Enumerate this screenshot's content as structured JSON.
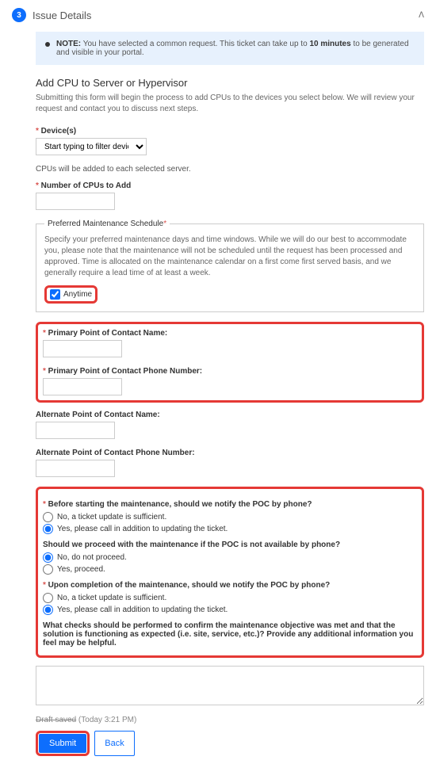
{
  "header": {
    "step": "3",
    "title": "Issue Details"
  },
  "note": {
    "label": "NOTE:",
    "body": " You have selected a common request. This ticket can take up to ",
    "bold": "10 minutes",
    "tail": " to be generated and visible in your portal."
  },
  "form": {
    "title": "Add CPU to Server or Hypervisor",
    "subtitle": "Submitting this form will begin the process to add CPUs to the devices you select below. We will review your request and contact you to discuss next steps.",
    "devices_label": "Device(s)",
    "devices_placeholder": "Start typing to filter devices",
    "devices_helper": "CPUs will be added to each selected server.",
    "num_cpus_label": "Number of CPUs to Add"
  },
  "schedule": {
    "legend": "Preferred Maintenance Schedule",
    "desc": "Specify your preferred maintenance days and time windows. While we will do our best to accommodate you, please note that the maintenance will not be scheduled until the request has been processed and approved. Time is allocated on the maintenance calendar on a first come first served basis, and we generally require a lead time of at least a week.",
    "anytime_label": "Anytime"
  },
  "contacts": {
    "primary_name_label": "Primary Point of Contact Name:",
    "primary_phone_label": "Primary Point of Contact Phone Number:",
    "alt_name_label": "Alternate Point of Contact Name:",
    "alt_phone_label": "Alternate Point of Contact Phone Number:"
  },
  "questions": {
    "q1_label": "Before starting the maintenance, should we notify the POC by phone?",
    "q1_opt1": "No, a ticket update is sufficient.",
    "q1_opt2": "Yes, please call in addition to updating the ticket.",
    "q2_label": "Should we proceed with the maintenance if the POC is not available by phone?",
    "q2_opt1": "No, do not proceed.",
    "q2_opt2": "Yes, proceed.",
    "q3_label": "Upon completion of the maintenance, should we notify the POC by phone?",
    "q3_opt1": "No, a ticket update is sufficient.",
    "q3_opt2": "Yes, please call in addition to updating the ticket.",
    "q4_label": "What checks should be performed to confirm the maintenance objective was met and that the solution is functioning as expected (i.e. site, service, etc.)? Provide any additional information you feel may be helpful."
  },
  "footer": {
    "draft_label": "Draft saved",
    "draft_time": "(Today 3:21 PM)",
    "submit": "Submit",
    "back": "Back"
  }
}
